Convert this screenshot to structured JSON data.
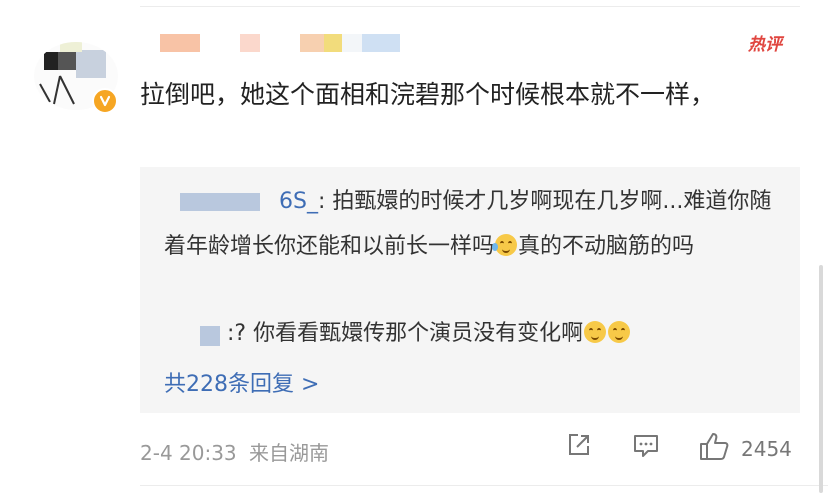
{
  "comment": {
    "hot_tag": "热评",
    "text": "拉倒吧，她这个面相和浣碧那个时候根本就不一样，",
    "time": "2-4 20:33",
    "source": "来自湖南",
    "like_count": "2454"
  },
  "replies": [
    {
      "username": "6S_",
      "separator": ":",
      "text_before_emoji": " 拍甄嬛的时候才几岁啊现在几岁啊...难道你随着年龄增长你还能和以前长一样吗",
      "text_after_emoji": "真的不动脑筋的吗"
    },
    {
      "username": "",
      "separator": ":",
      "text": "? 你看看甄嬛传那个演员没有变化啊"
    }
  ],
  "more_replies": "共228条回复 >",
  "icons": {
    "verified": "verified-badge-icon",
    "share": "share-icon",
    "comment": "comment-icon",
    "like": "thumbs-up-icon",
    "emoji_laugh_cry": "laugh-cry-emoji",
    "emoji_smile": "smile-emoji"
  },
  "colors": {
    "link": "#3e6db5",
    "hot": "#e0453f",
    "badge": "#f6a623",
    "reply_bg": "#f5f5f5"
  }
}
